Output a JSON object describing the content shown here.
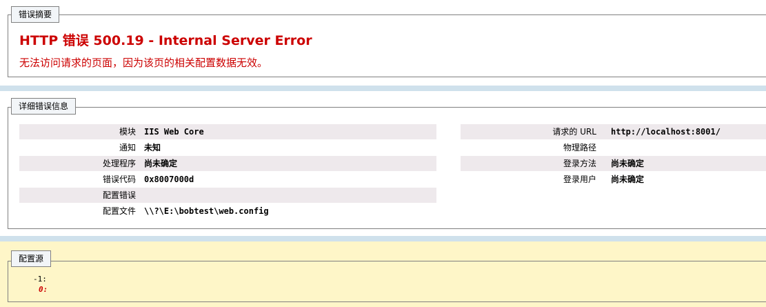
{
  "summary": {
    "legend": "错误摘要",
    "title": "HTTP 错误 500.19 - Internal Server Error",
    "description": "无法访问请求的页面，因为该页的相关配置数据无效。"
  },
  "details": {
    "legend": "详细错误信息",
    "left": [
      {
        "label": "模块",
        "value": "IIS Web Core"
      },
      {
        "label": "通知",
        "value": "未知"
      },
      {
        "label": "处理程序",
        "value": "尚未确定"
      },
      {
        "label": "错误代码",
        "value": "0x8007000d"
      },
      {
        "label": "配置错误",
        "value": ""
      },
      {
        "label": "配置文件",
        "value": "\\\\?\\E:\\bobtest\\web.config"
      }
    ],
    "right": [
      {
        "label": "请求的 URL",
        "value": "http://localhost:8001/"
      },
      {
        "label": "物理路径",
        "value": ""
      },
      {
        "label": "登录方法",
        "value": "尚未确定"
      },
      {
        "label": "登录用户",
        "value": "尚未确定"
      }
    ]
  },
  "config_source": {
    "legend": "配置源",
    "lines": [
      "-1:",
      "0:"
    ]
  },
  "colors": {
    "error_red": "#cc0000",
    "band_blue": "#cfe1ec",
    "row_shade": "#eee9ec",
    "source_bg": "#fef6c8"
  }
}
